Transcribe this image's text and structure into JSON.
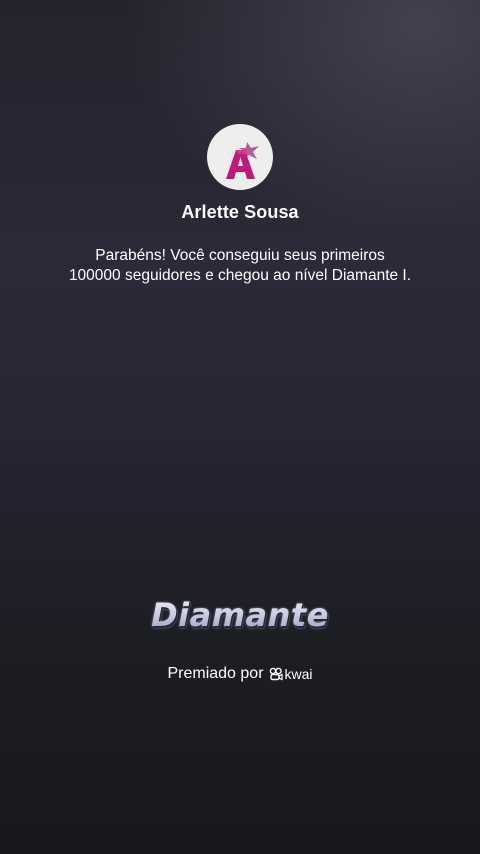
{
  "profile": {
    "name": "Arlette Sousa",
    "avatar_icon": "letter-a-avatar-icon"
  },
  "message": {
    "line1": "Parabéns! Você conseguiu seus primeiros",
    "line2": "100000 seguidores e chegou ao nível Diamante I."
  },
  "level": {
    "title": "Diamante"
  },
  "awarded": {
    "label": "Premiado por",
    "brand": "kwai",
    "brand_icon": "kwai-logo-icon"
  },
  "colors": {
    "background_top": "#24242e",
    "background_bottom": "#18181c",
    "avatar_bg": "#eeeeee",
    "avatar_letter": "#c2187a",
    "level_title": "#d4d4e6"
  }
}
